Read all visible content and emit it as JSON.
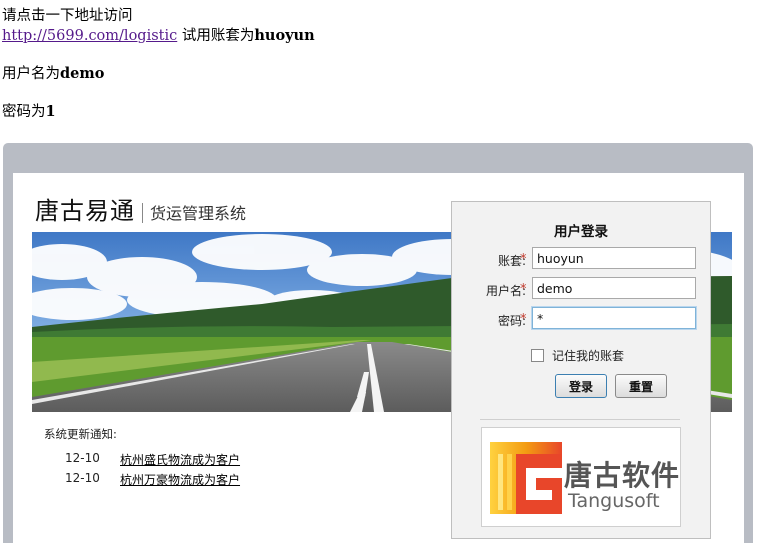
{
  "intro": {
    "line1": "请点击一下地址访问",
    "link": "http://5699.com/logistic",
    "trial_prefix": "试用账套为",
    "trial_account": "huoyun",
    "user_prefix": "用户名为",
    "user_value": "demo",
    "pwd_prefix": "密码为",
    "pwd_value": "1"
  },
  "brand": {
    "name": "唐古易通",
    "subtitle": "货运管理系统"
  },
  "notice": {
    "title": "系统更新通知:",
    "items": [
      {
        "date": "12-10",
        "text": "杭州盛氏物流成为客户"
      },
      {
        "date": "12-10",
        "text": "杭州万豪物流成为客户"
      }
    ]
  },
  "login": {
    "title": "用户登录",
    "account_label": "账套:",
    "account_value": "huoyun",
    "username_label": "用户名:",
    "username_value": "demo",
    "password_label": "密码:",
    "password_value": "*",
    "required_mark": "*",
    "remember_label": "记住我的账套",
    "remember_checked": false,
    "login_button": "登录",
    "reset_button": "重置"
  },
  "company_logo": {
    "cn": "唐古软件",
    "en": "Tangusoft"
  },
  "colors": {
    "frame": "#b8bcc4",
    "link_visited": "#551a8b",
    "required": "#c0392b",
    "logo_orange": "#f39c12",
    "logo_red": "#e8462a"
  }
}
